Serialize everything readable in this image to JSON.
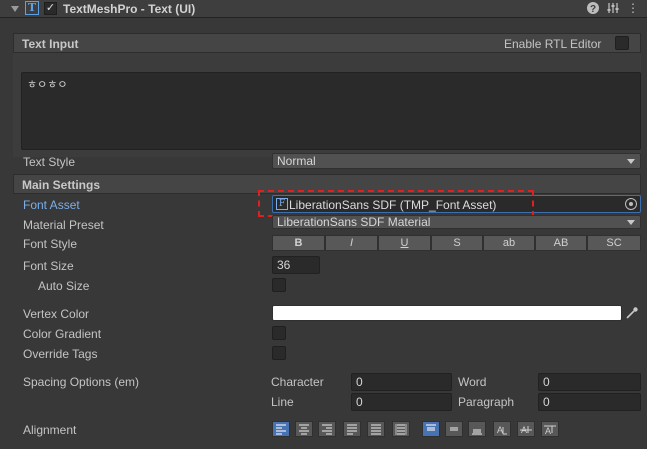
{
  "header": {
    "title": "TextMeshPro - Text (UI)",
    "component_icon_letter": "T",
    "enabled_check": "✓",
    "help_icon": "?",
    "settings_icon": "⋮",
    "help_icon_name": "help-icon",
    "presets_icon_name": "presets-icon",
    "menu_icon_name": "kebab-menu-icon"
  },
  "text_input": {
    "section_title": "Text Input",
    "rtl_label": "Enable RTL Editor",
    "value": "ㅎㅇㅎㅇ"
  },
  "text_style": {
    "label": "Text Style",
    "value": "Normal"
  },
  "main_settings": {
    "section_title": "Main Settings",
    "font_asset_label": "Font Asset",
    "font_asset_value": "LiberationSans SDF (TMP_Font Asset)",
    "font_asset_icon_letter": "F",
    "material_preset_label": "Material Preset",
    "material_preset_value": "LiberationSans SDF Material",
    "font_style_label": "Font Style",
    "font_style_buttons": [
      "B",
      "I",
      "U",
      "S",
      "ab",
      "AB",
      "SC"
    ],
    "font_size_label": "Font Size",
    "font_size_value": "36",
    "auto_size_label": "Auto Size",
    "vertex_color_label": "Vertex Color",
    "vertex_color_value": "#ffffff",
    "color_gradient_label": "Color Gradient",
    "override_tags_label": "Override Tags",
    "spacing_label": "Spacing Options (em)",
    "character_label": "Character",
    "character_value": "0",
    "word_label": "Word",
    "word_value": "0",
    "line_label": "Line",
    "line_value": "0",
    "paragraph_label": "Paragraph",
    "paragraph_value": "0",
    "alignment_label": "Alignment"
  },
  "colors": {
    "accent": "#4772b3",
    "highlight": "#e02020",
    "font_asset_label": "#7baee8"
  }
}
